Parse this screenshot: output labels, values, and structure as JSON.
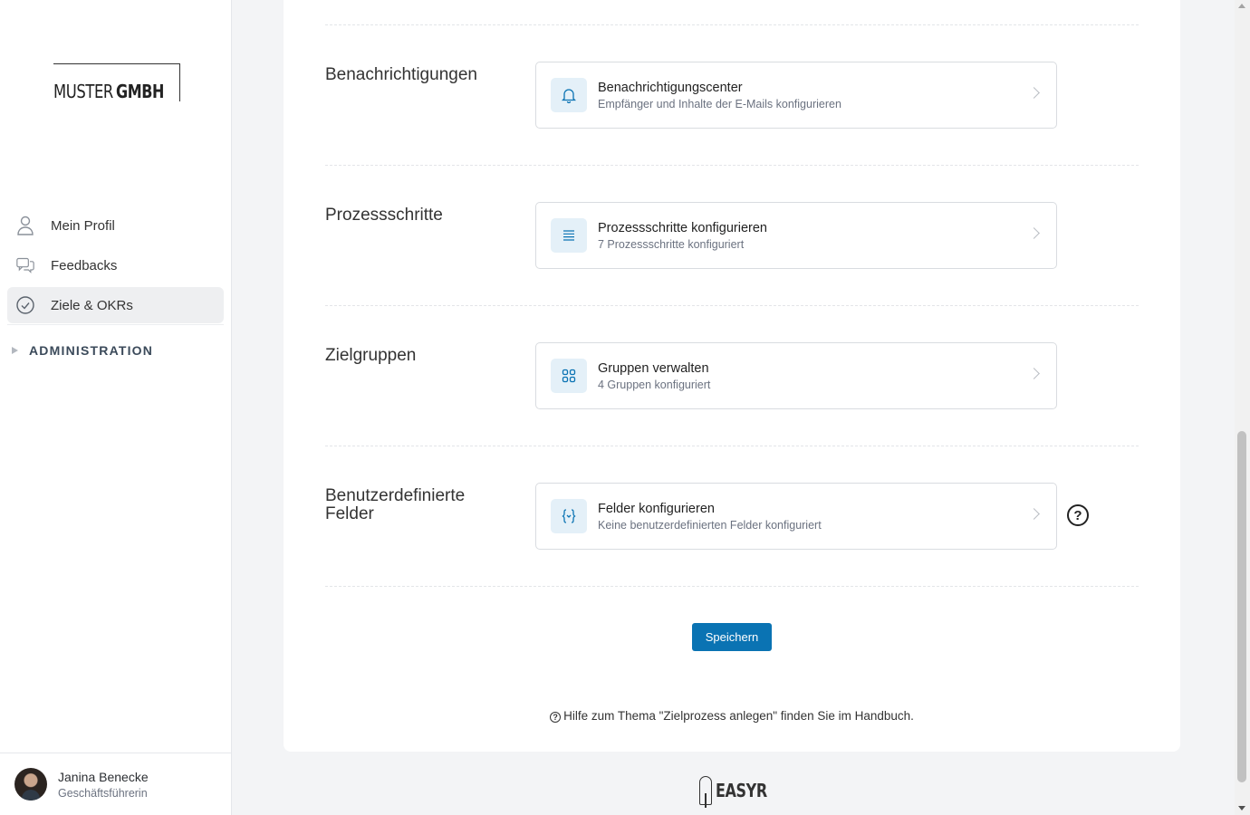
{
  "sidebar": {
    "logo": {
      "light": "MUSTER",
      "bold": "GMBH"
    },
    "nav": [
      {
        "label": "Mein Profil",
        "icon": "user-icon"
      },
      {
        "label": "Feedbacks",
        "icon": "chat-bubbles-icon"
      },
      {
        "label": "Ziele & OKRs",
        "icon": "check-circle-icon",
        "active": true
      }
    ],
    "admin_label": "ADMINISTRATION",
    "user": {
      "name": "Janina Benecke",
      "role": "Geschäftsführerin"
    }
  },
  "sections": [
    {
      "title": "Benachrichtigungen",
      "row_title": "Benachrichtigungscenter",
      "row_sub": "Empfänger und Inhalte der E-Mails konfigurieren",
      "icon": "bell-icon"
    },
    {
      "title": "Prozessschritte",
      "row_title": "Prozessschritte konfigurieren",
      "row_sub": "7 Prozessschritte konfiguriert",
      "icon": "list-icon"
    },
    {
      "title": "Zielgruppen",
      "row_title": "Gruppen verwalten",
      "row_sub": "4 Gruppen konfiguriert",
      "icon": "grid-icon"
    },
    {
      "title": "Benutzerdefinierte Felder",
      "row_title": "Felder konfigurieren",
      "row_sub": "Keine benutzerdefinierten Felder konfiguriert",
      "icon": "braces-icon"
    }
  ],
  "help_glyph": "?",
  "save_label": "Speichern",
  "hint": {
    "glyph": "?",
    "text": "Hilfe zum Thema \"Zielprozess anlegen\" finden Sie im Handbuch."
  },
  "footer_brand": "EASYR",
  "colors": {
    "primary": "#0a73b3",
    "icon_bg": "#e4f0f8",
    "icon_fg": "#0a73b3"
  }
}
